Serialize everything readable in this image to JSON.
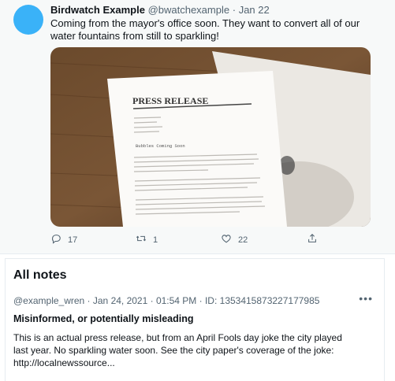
{
  "tweet": {
    "author_name": "Birdwatch Example",
    "handle": "@bwatchexample",
    "separator": "·",
    "date": "Jan 22",
    "text": "Coming from the mayor's office soon. They want to convert all of our water fountains from still to sparkling!",
    "image": {
      "heading": "PRESS RELEASE",
      "subheading": "Bubbles Coming Soon"
    },
    "actions": {
      "replies": "17",
      "retweets": "1",
      "likes": "22"
    }
  },
  "notes": {
    "title": "All notes",
    "note": {
      "meta": "@example_wren · Jan 24, 2021 · 01:54 PM · ID: 1353415873227177985",
      "more_icon": "•••",
      "classification": "Misinformed, or potentially misleading",
      "text": "This is an actual press release, but from an April Fools day joke the city played last year. No sparkling water soon. See the city paper's coverage of the joke: http://localnewssource..."
    }
  },
  "icons": [
    "reply-icon",
    "retweet-icon",
    "like-icon",
    "share-icon",
    "more-icon"
  ],
  "colors": {
    "avatar": "#3ab2f8",
    "muted": "#536471",
    "tweet_bg": "#f7f9f9"
  }
}
